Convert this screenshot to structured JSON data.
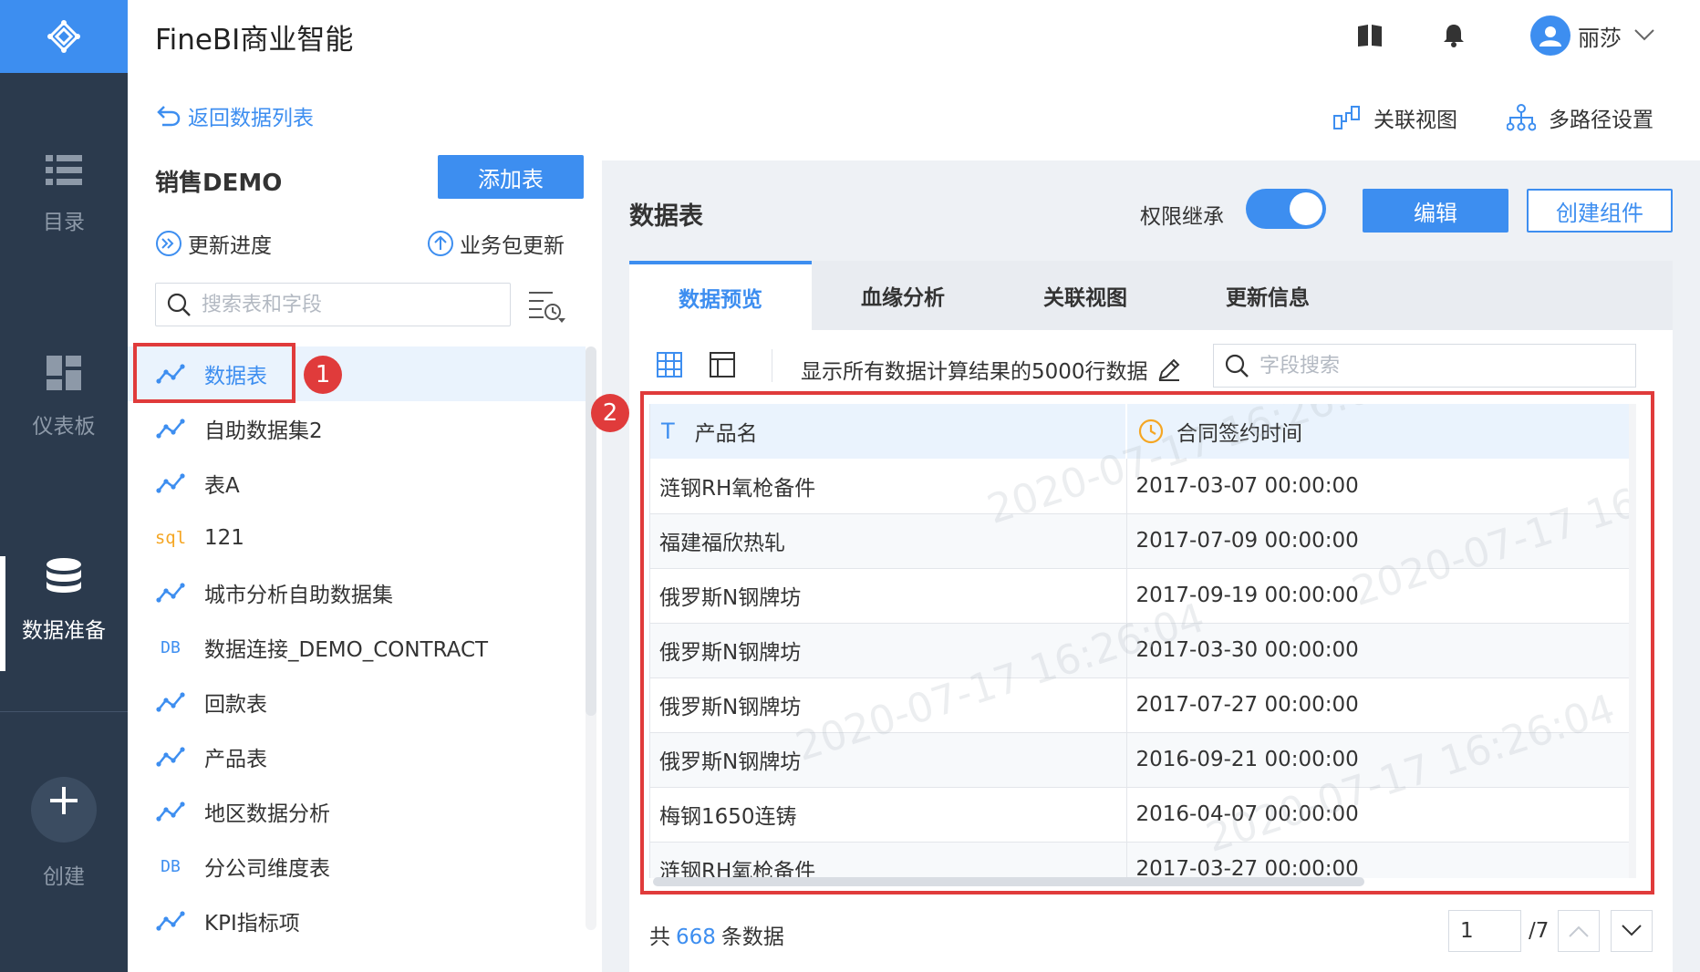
{
  "app": {
    "title": "FineBI商业智能"
  },
  "user": {
    "name": "丽莎"
  },
  "nav": {
    "items": [
      {
        "label": "目录",
        "icon": "list-icon"
      },
      {
        "label": "仪表板",
        "icon": "dashboard-icon"
      },
      {
        "label": "数据准备",
        "icon": "database-icon",
        "active": true
      },
      {
        "label": "创建",
        "icon": "plus-icon"
      }
    ]
  },
  "left_panel": {
    "back_label": "返回数据列表",
    "package_name": "销售DEMO",
    "add_table_label": "添加表",
    "update_progress_label": "更新进度",
    "package_update_label": "业务包更新",
    "search_placeholder": "搜索表和字段",
    "tables": [
      {
        "name": "数据表",
        "type": "self-service"
      },
      {
        "name": "自助数据集2",
        "type": "self-service"
      },
      {
        "name": "表A",
        "type": "self-service"
      },
      {
        "name": "121",
        "type": "sql"
      },
      {
        "name": "城市分析自助数据集",
        "type": "self-service"
      },
      {
        "name": "数据连接_DEMO_CONTRACT",
        "type": "db"
      },
      {
        "name": "回款表",
        "type": "self-service"
      },
      {
        "name": "产品表",
        "type": "self-service"
      },
      {
        "name": "地区数据分析",
        "type": "self-service"
      },
      {
        "name": "分公司维度表",
        "type": "db"
      },
      {
        "name": "KPI指标项",
        "type": "self-service"
      }
    ],
    "type_labels": {
      "sql": "sql",
      "db": "DB"
    }
  },
  "annotations": {
    "one": "1",
    "two": "2"
  },
  "right_panel": {
    "relation_view_label": "关联视图",
    "multipath_label": "多路径设置",
    "section_title": "数据表",
    "permission_label": "权限继承",
    "permission_on": true,
    "edit_label": "编辑",
    "create_component_label": "创建组件",
    "tabs": [
      "数据预览",
      "血缘分析",
      "关联视图",
      "更新信息"
    ],
    "preview_note": "显示所有数据计算结果的5000行数据",
    "field_search_placeholder": "字段搜索",
    "columns": [
      {
        "type_icon": "T",
        "name": "产品名"
      },
      {
        "type_icon": "clock-icon",
        "name": "合同签约时间"
      }
    ],
    "rows": [
      [
        "涟钢RH氧枪备件",
        "2017-03-07 00:00:00"
      ],
      [
        "福建福欣热轧",
        "2017-07-09 00:00:00"
      ],
      [
        "俄罗斯N钢牌坊",
        "2017-09-19 00:00:00"
      ],
      [
        "俄罗斯N钢牌坊",
        "2017-03-30 00:00:00"
      ],
      [
        "俄罗斯N钢牌坊",
        "2017-07-27 00:00:00"
      ],
      [
        "俄罗斯N钢牌坊",
        "2016-09-21 00:00:00"
      ],
      [
        "梅钢1650连铸",
        "2016-04-07 00:00:00"
      ],
      [
        "涟钢RH氧枪备件",
        "2017-03-27 00:00:00"
      ]
    ],
    "watermark": "2020-07-17 16:26:04",
    "total_prefix": "共",
    "total_count": "668",
    "total_suffix": "条数据",
    "page_current": "1",
    "page_total": "/7"
  },
  "colors": {
    "accent": "#3d8ef0",
    "rail": "#2b3a4d",
    "annotation": "#e03b3b",
    "sql": "#f5a623"
  }
}
